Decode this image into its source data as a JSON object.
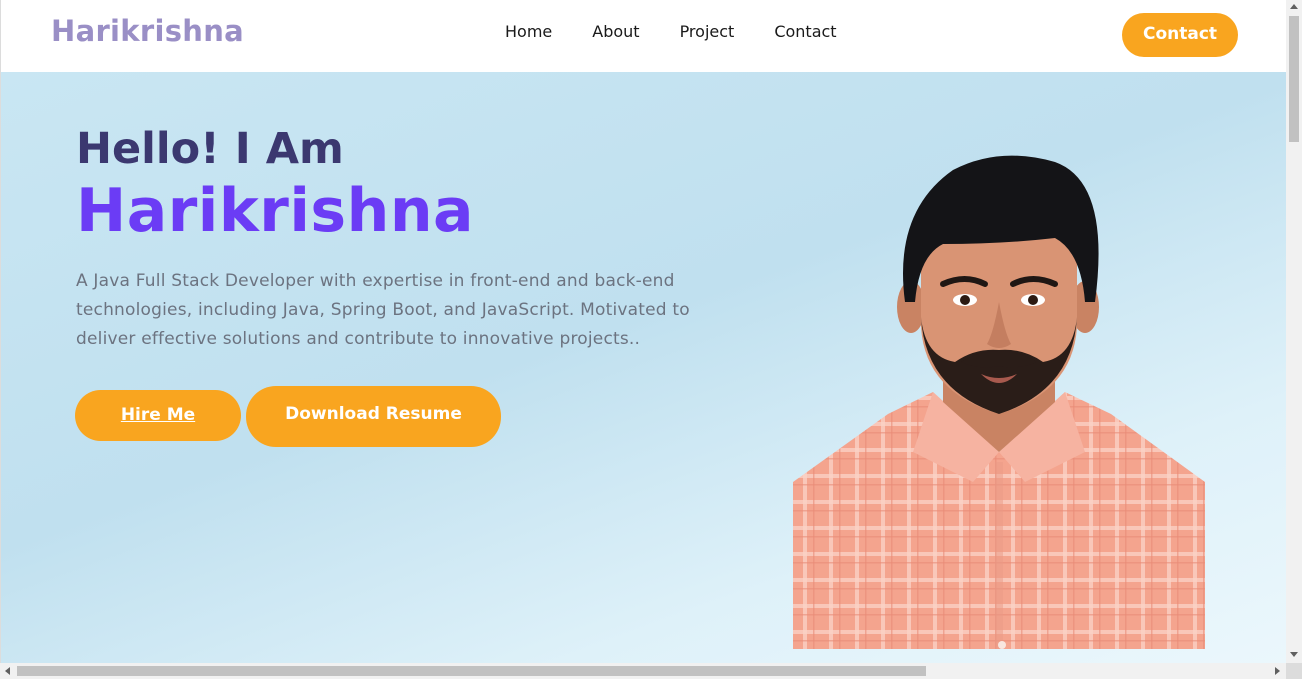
{
  "navbar": {
    "brand": "Harikrishna",
    "links": [
      "Home",
      "About",
      "Project",
      "Contact"
    ],
    "cta_label": "Contact"
  },
  "hero": {
    "greeting": "Hello! I Am",
    "name": "Harikrishna",
    "description": "A Java Full Stack Developer with expertise in front-end and back-end technologies, including Java, Spring Boot, and JavaScript. Motivated to deliver effective solutions and contribute to innovative projects..",
    "hire_label": "Hire Me",
    "resume_label": "Download Resume"
  },
  "colors": {
    "accent": "#f9a51f",
    "brand": "#9a8fc6",
    "name_purple": "#6b3cf5",
    "greeting": "#3b3870"
  }
}
